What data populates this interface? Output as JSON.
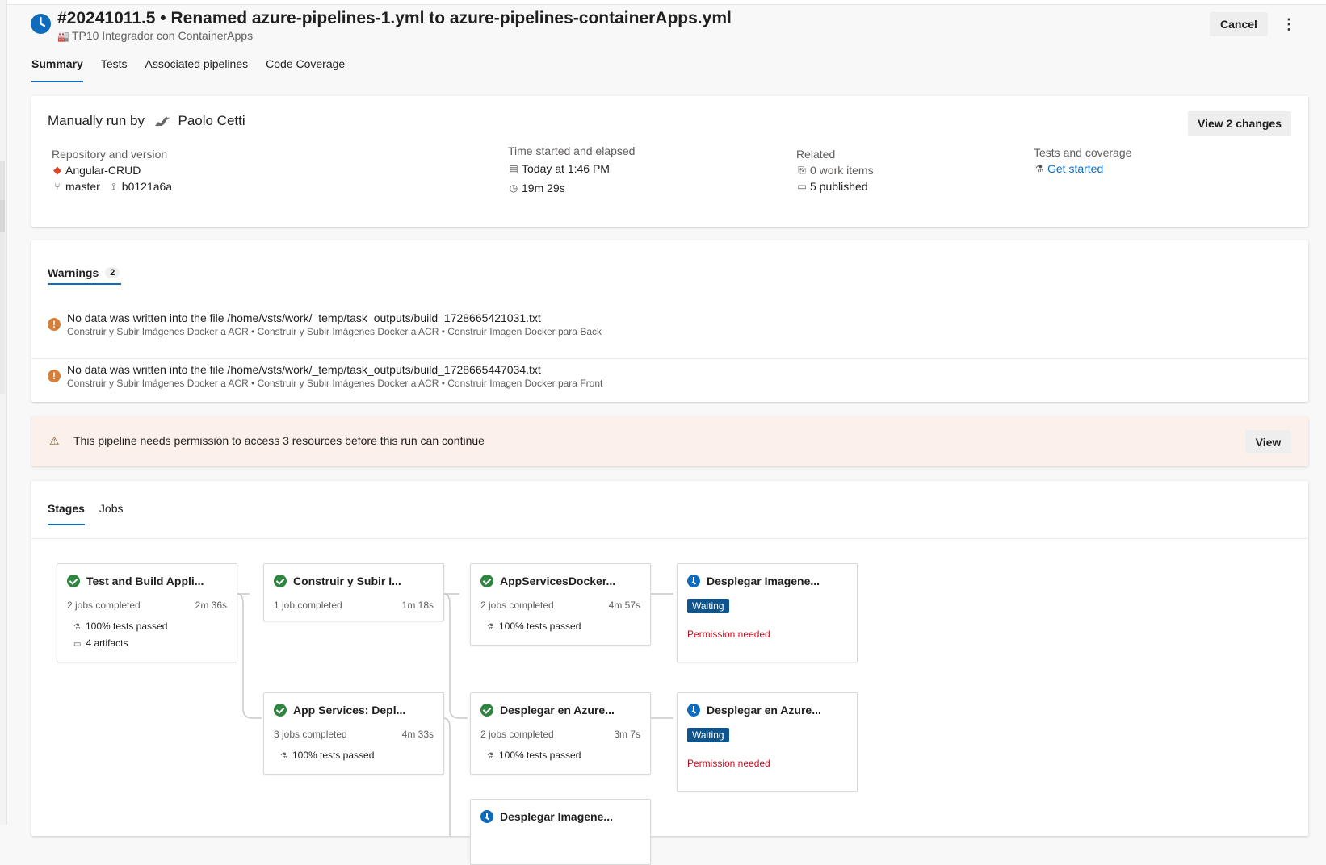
{
  "header": {
    "run_title": "#20241011.5 • Renamed azure-pipelines-1.yml to azure-pipelines-containerApps.yml",
    "pipeline_name": "TP10 Integrador con ContainerApps",
    "cancel_label": "Cancel",
    "more_label": "⋮"
  },
  "tabs": [
    {
      "label": "Summary",
      "active": true
    },
    {
      "label": "Tests"
    },
    {
      "label": "Associated pipelines"
    },
    {
      "label": "Code Coverage"
    }
  ],
  "summary": {
    "manual_run_prefix": "Manually run by",
    "user_name": "Paolo Cetti",
    "view_changes_label": "View 2 changes",
    "repository_label": "Repository and version",
    "repository_name": "Angular-CRUD",
    "branch": "master",
    "commit": "b0121a6a",
    "time_label": "Time started and elapsed",
    "started": "Today at 1:46 PM",
    "elapsed": "19m 29s",
    "related_label": "Related",
    "work_items": "0 work items",
    "published": "5 published",
    "tests_label": "Tests and coverage",
    "get_started": "Get started"
  },
  "warnings": {
    "tab_label": "Warnings",
    "count": "2",
    "items": [
      {
        "message": "No data was written into the file /home/vsts/work/_temp/task_outputs/build_1728665421031.txt",
        "path": "Construir y Subir Imágenes Docker a ACR • Construir y Subir Imágenes Docker a ACR • Construir Imagen Docker para Back"
      },
      {
        "message": "No data was written into the file /home/vsts/work/_temp/task_outputs/build_1728665447034.txt",
        "path": "Construir y Subir Imágenes Docker a ACR • Construir y Subir Imágenes Docker a ACR • Construir Imagen Docker para Front"
      }
    ]
  },
  "permission": {
    "message": "This pipeline needs permission to access 3 resources before this run can continue",
    "view_label": "View"
  },
  "stages_tabs": [
    {
      "label": "Stages",
      "active": true
    },
    {
      "label": "Jobs"
    }
  ],
  "stages": [
    {
      "name": "Test and Build Appli...",
      "status": "succeeded",
      "jobs": "2 jobs completed",
      "duration": "2m 36s",
      "tests": "100% tests passed",
      "artifacts": "4 artifacts"
    },
    {
      "name": "Construir y Subir I...",
      "status": "succeeded",
      "jobs": "1 job completed",
      "duration": "1m 18s"
    },
    {
      "name": "AppServicesDocker...",
      "status": "succeeded",
      "jobs": "2 jobs completed",
      "duration": "4m 57s",
      "tests": "100% tests passed"
    },
    {
      "name": "Desplegar Imagene...",
      "status": "waiting",
      "badge": "Waiting",
      "note": "Permission needed"
    },
    {
      "name": "App Services: Depl...",
      "status": "succeeded",
      "jobs": "3 jobs completed",
      "duration": "4m 33s",
      "tests": "100% tests passed"
    },
    {
      "name": "Desplegar en Azure...",
      "status": "succeeded",
      "jobs": "2 jobs completed",
      "duration": "3m 7s",
      "tests": "100% tests passed"
    },
    {
      "name": "Desplegar en Azure...",
      "status": "waiting",
      "badge": "Waiting",
      "note": "Permission needed"
    },
    {
      "name": "Desplegar Imagene...",
      "status": "waiting"
    }
  ],
  "colors": {
    "accent": "#0f6cbd",
    "success": "#2e8540",
    "warning": "#d67f3c",
    "error": "#c50f1f",
    "banner_bg": "#fbf1ea"
  },
  "icons": {
    "run_status": "clock-icon",
    "pipeline": "pipeline-icon",
    "repo": "git-icon",
    "branch": "branch-icon",
    "commit": "commit-icon",
    "calendar": "calendar-icon",
    "timer": "timer-icon",
    "work_items": "work-item-icon",
    "artifacts": "artifact-icon",
    "tests": "flask-icon",
    "warning": "warning-icon",
    "permission": "warning-triangle-icon"
  }
}
